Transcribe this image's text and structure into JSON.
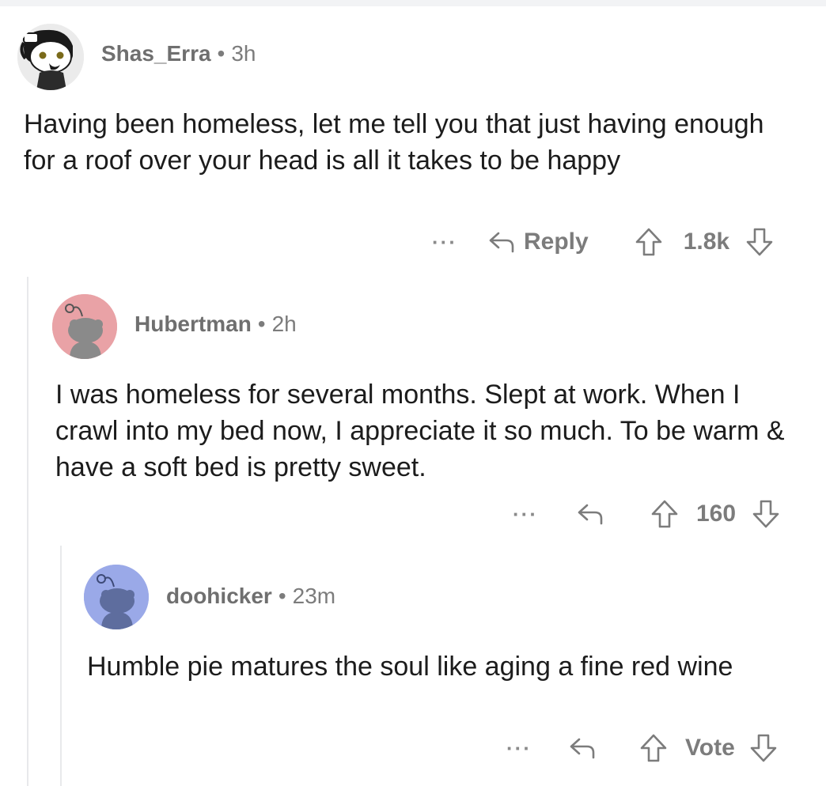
{
  "comments": [
    {
      "username": "Shas_Erra",
      "separator": "•",
      "time": "3h",
      "text": "Having been homeless, let me tell you that just having enough for a roof over your head is all it takes to be happy",
      "more": "···",
      "reply_label": "Reply",
      "vote_count": "1.8k",
      "avatar_color": "#ebebeb"
    },
    {
      "username": "Hubertman",
      "separator": "•",
      "time": "2h",
      "text": "I was homeless for several months. Slept at work. When I crawl into my bed now, I appreciate it so much.  To be warm & have a soft bed is pretty sweet.",
      "more": "···",
      "vote_count": "160",
      "avatar_color": "#e9a2a6"
    },
    {
      "username": "doohicker",
      "separator": "•",
      "time": "23m",
      "text": "Humble pie matures the soul like aging a fine red wine",
      "more": "···",
      "vote_count": "Vote",
      "avatar_color": "#9aa9e8"
    }
  ],
  "colors": {
    "meta_text": "#7c7c7c",
    "thread_line": "#e8e9eb",
    "body_text": "#1c1c1c"
  }
}
